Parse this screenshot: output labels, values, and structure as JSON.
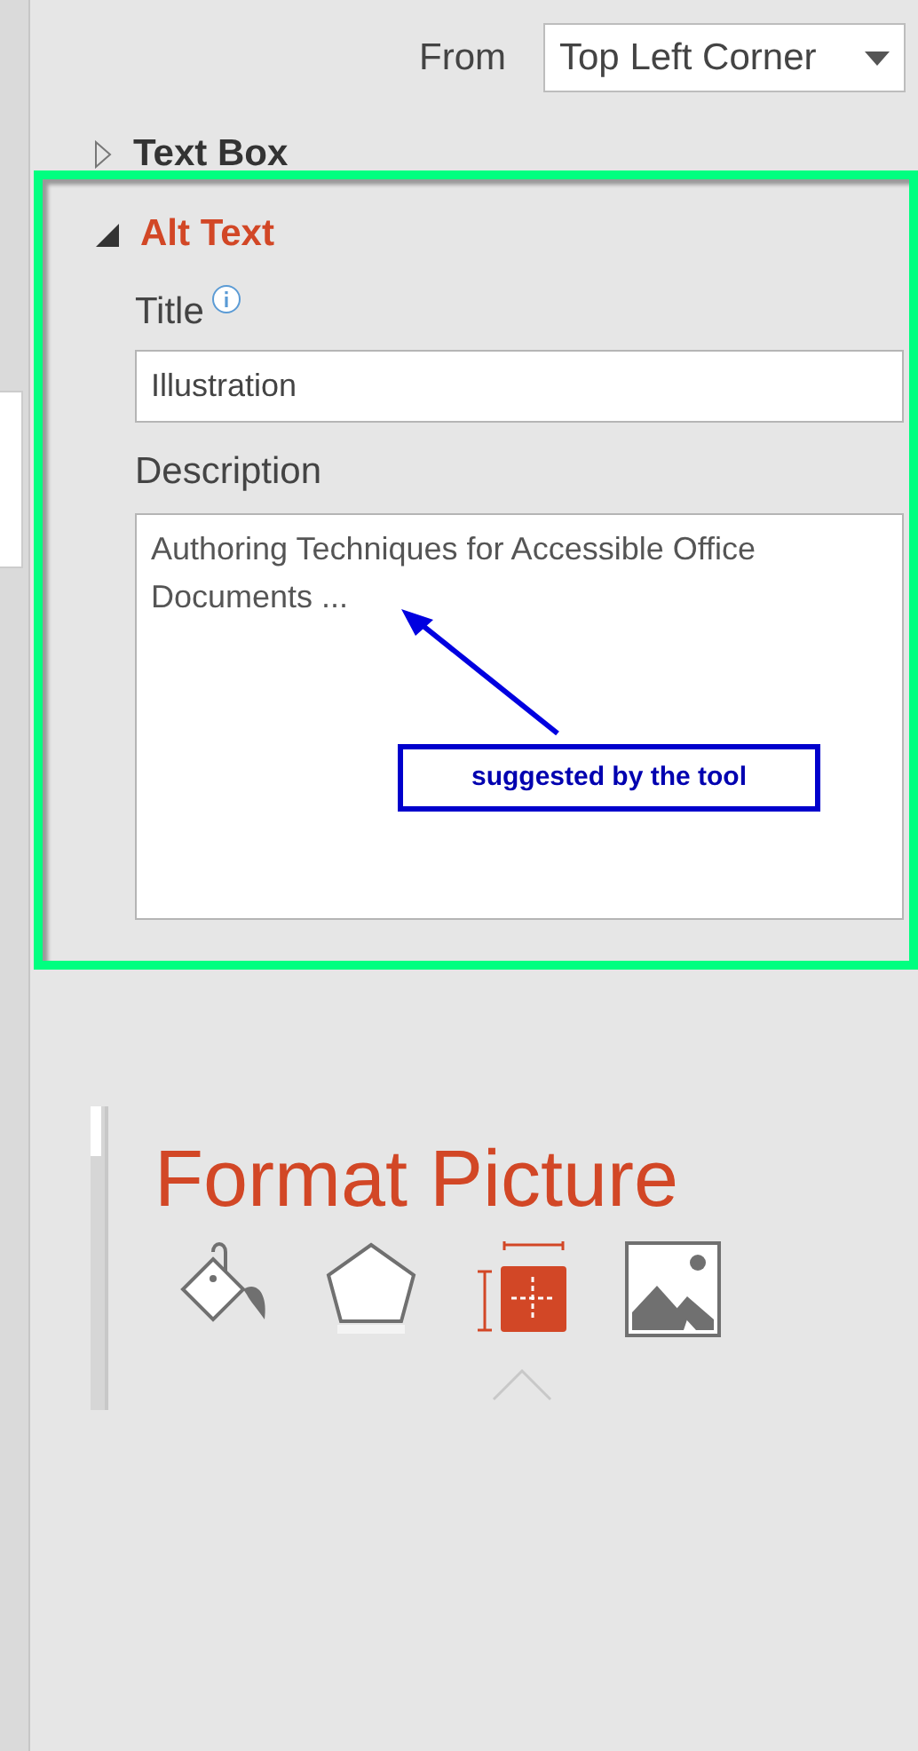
{
  "position": {
    "label": "From",
    "value": "Top Left Corner"
  },
  "sections": [
    {
      "title": "Text Box",
      "expanded": false
    },
    {
      "title": "Alt Text",
      "expanded": true,
      "title_label": "Title",
      "title_value": "Illustration",
      "description_label": "Description",
      "description_value": "Authoring Techniques for Accessible Office Documents ..."
    }
  ],
  "annotation": {
    "text": "suggested by the tool"
  },
  "format_pane": {
    "title": "Format Picture",
    "tabs": [
      {
        "kind": "fill",
        "selected": false
      },
      {
        "kind": "effects",
        "selected": false
      },
      {
        "kind": "size",
        "selected": true
      },
      {
        "kind": "picture",
        "selected": false
      }
    ]
  }
}
